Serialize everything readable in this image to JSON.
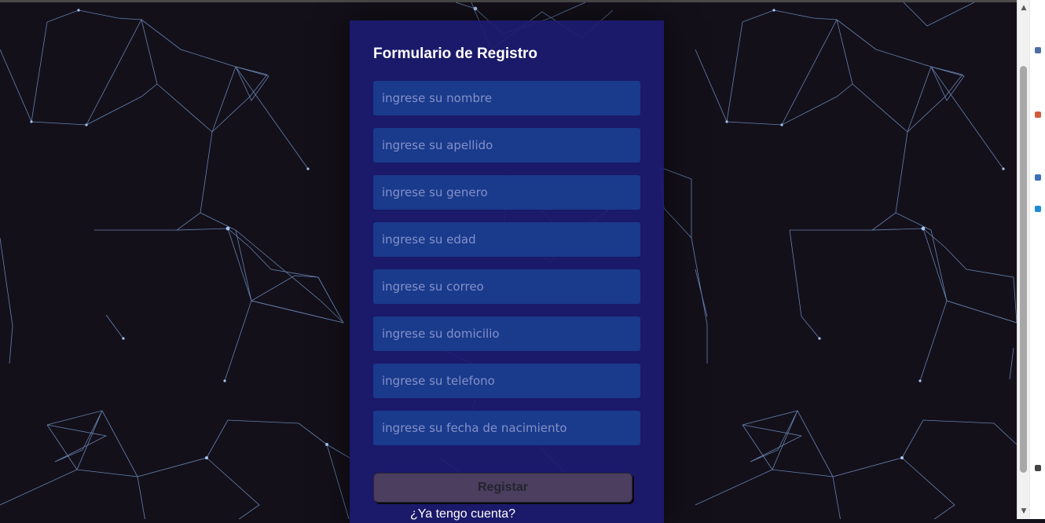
{
  "form": {
    "title": "Formulario de Registro",
    "fields": [
      {
        "name": "nombre-input",
        "placeholder": "ingrese su nombre"
      },
      {
        "name": "apellido-input",
        "placeholder": "ingrese su apellido"
      },
      {
        "name": "genero-input",
        "placeholder": "ingrese su genero"
      },
      {
        "name": "edad-input",
        "placeholder": "ingrese su edad"
      },
      {
        "name": "correo-input",
        "placeholder": "ingrese su correo"
      },
      {
        "name": "domicilio-input",
        "placeholder": "ingrese su domicilio"
      },
      {
        "name": "telefono-input",
        "placeholder": "ingrese su telefono"
      },
      {
        "name": "fecha-nacimiento-input",
        "placeholder": "ingrese su fecha de nacimiento"
      }
    ],
    "submit_label": "Registar",
    "login_link": "¿Ya tengo cuenta?"
  },
  "colors": {
    "background": "#14101a",
    "card": "#1c1a70",
    "field": "#1a3a8c",
    "network_line": "#7fa8e0",
    "submit": "#4b3e5e"
  },
  "icons": {
    "scroll_up": "scroll-up-arrow-icon",
    "scroll_down": "scroll-down-arrow-icon"
  }
}
